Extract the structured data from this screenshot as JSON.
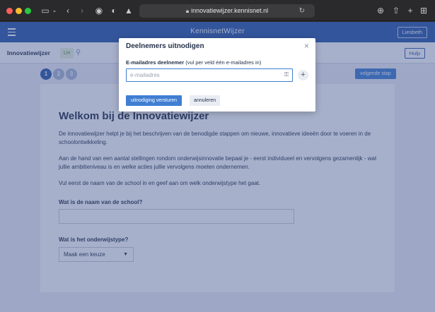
{
  "browser": {
    "url": "innovatiewijzer.kennisnet.nl"
  },
  "app": {
    "brand": "KennisnetWijzer",
    "user_button": "Liesbeth",
    "subbar_title": "Innovatiewijzer",
    "avatar_initials": "LH",
    "help_button": "Hulp",
    "steps": [
      "1",
      "2",
      "3"
    ],
    "next_button": "volgende stap"
  },
  "card": {
    "heading": "Welkom bij de Innovatiewijzer",
    "paragraphs": [
      "De innovatiewijzer helpt je bij het beschrijven van de benodigde stappen om nieuwe, innovatieve ideeën door te voeren in de schoolontwikkeling.",
      "Aan de hand van een aantal stellingen rondom onderwijsinnovatie bepaal je - eerst individueel en vervolgens gezamenlijk - wat jullie ambitieniveau is en welke acties jullie vervolgens moeten ondernemen.",
      "Vul eerst de naam van de school in en geef aan om welk onderwijstype het gaat."
    ],
    "school_name_question": "Wat is de naam van de school?",
    "school_type_question": "Wat is het onderwijstype?",
    "school_type_select": "Maak een keuze"
  },
  "modal": {
    "title": "Deelnemers uitnodigen",
    "label_bold": "E-mailadres deelnemer",
    "label_rest": " (vul per veld één e-mailadres in)",
    "email_placeholder": "e-mailadres",
    "add_symbol": "+",
    "send_button": "uitnodiging versturen",
    "cancel_button": "annuleren",
    "close_symbol": "×"
  }
}
